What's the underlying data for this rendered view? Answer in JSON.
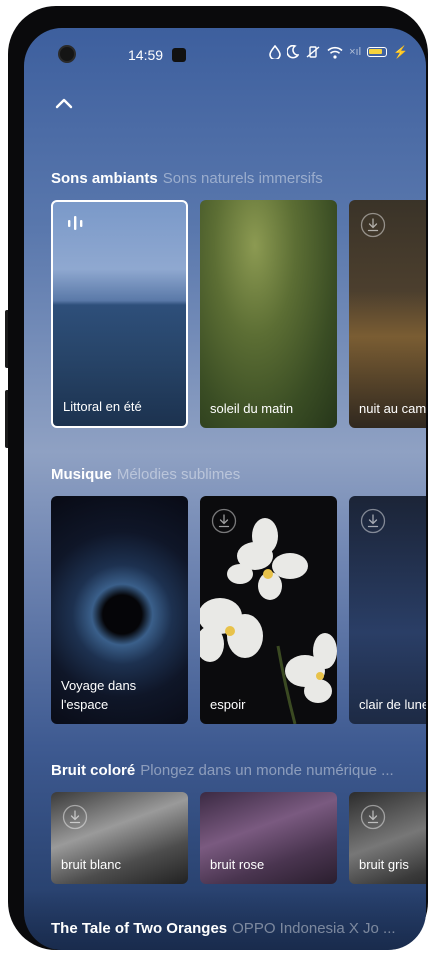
{
  "status_bar": {
    "time": "14:59",
    "network": "×ıl"
  },
  "sections": [
    {
      "title": "Sons ambiants",
      "subtitle": "Sons naturels immersifs",
      "cards": [
        {
          "label": "Littoral en été",
          "selected": true,
          "icon": "playing-bars-icon"
        },
        {
          "label": "soleil du matin",
          "icon": "none"
        },
        {
          "label": "nuit au camp",
          "icon": "download-icon"
        }
      ]
    },
    {
      "title": "Musique",
      "subtitle": "Mélodies sublimes",
      "cards": [
        {
          "label": "Voyage dans l'espace",
          "icon": "none"
        },
        {
          "label": "espoir",
          "icon": "download-icon"
        },
        {
          "label": "clair de lune",
          "icon": "download-icon"
        }
      ]
    },
    {
      "title": "Bruit coloré",
      "subtitle": "Plongez dans un monde numérique ...",
      "cards": [
        {
          "label": "bruit blanc",
          "icon": "download-icon"
        },
        {
          "label": "bruit rose",
          "icon": "none"
        },
        {
          "label": "bruit gris",
          "icon": "download-icon"
        }
      ]
    },
    {
      "title": "The Tale of Two Oranges",
      "subtitle": "OPPO Indonesia X Jo ..."
    }
  ]
}
